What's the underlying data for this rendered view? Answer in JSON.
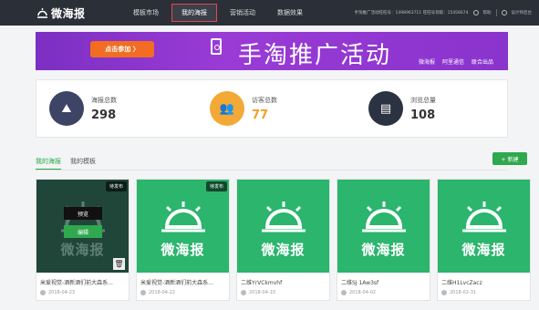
{
  "app": {
    "logo_text": "微海报"
  },
  "nav": [
    {
      "label": "模板市场",
      "active": false
    },
    {
      "label": "我的海报",
      "active": true
    },
    {
      "label": "营销活动",
      "active": false
    },
    {
      "label": "数据效果",
      "active": false
    }
  ],
  "topbar": {
    "account_info": "手淘推广活动旺旺号：1498963711   旺旺号领取：15456674 ",
    "help": "帮助",
    "design": "设计师后台"
  },
  "banner": {
    "button_label": "点击参加 〉",
    "title": "手淘推广活动",
    "partner1": "微海报",
    "partner2": "阿里通信",
    "partner3": "联合出品"
  },
  "stats": [
    {
      "label": "海报总数",
      "value": "298"
    },
    {
      "label": "访客总数",
      "value": "77"
    },
    {
      "label": "浏览总量",
      "value": "108"
    }
  ],
  "tabs": [
    {
      "label": "我的海报",
      "active": true
    },
    {
      "label": "我的模板",
      "active": false
    }
  ],
  "new_button": "+ 新建",
  "cards": [
    {
      "title": "米爱视觉-酒新酒们前大森系...",
      "date": "2018-04-23",
      "status": "待发布",
      "brand": "微海报",
      "preview": "预览",
      "edit": "编辑"
    },
    {
      "title": "米爱视觉-酒新酒们前大森系...",
      "date": "2018-04-22",
      "status": "待发布",
      "brand": "微海报"
    },
    {
      "title": "二维YrVCkmvhf",
      "date": "2018-04-10",
      "brand": "微海报"
    },
    {
      "title": "二维SJ 1Aw3sf",
      "date": "2018-04-02",
      "brand": "微海报"
    },
    {
      "title": "二维H1LvcZacz",
      "date": "2018-02-31",
      "brand": "微海报"
    }
  ]
}
